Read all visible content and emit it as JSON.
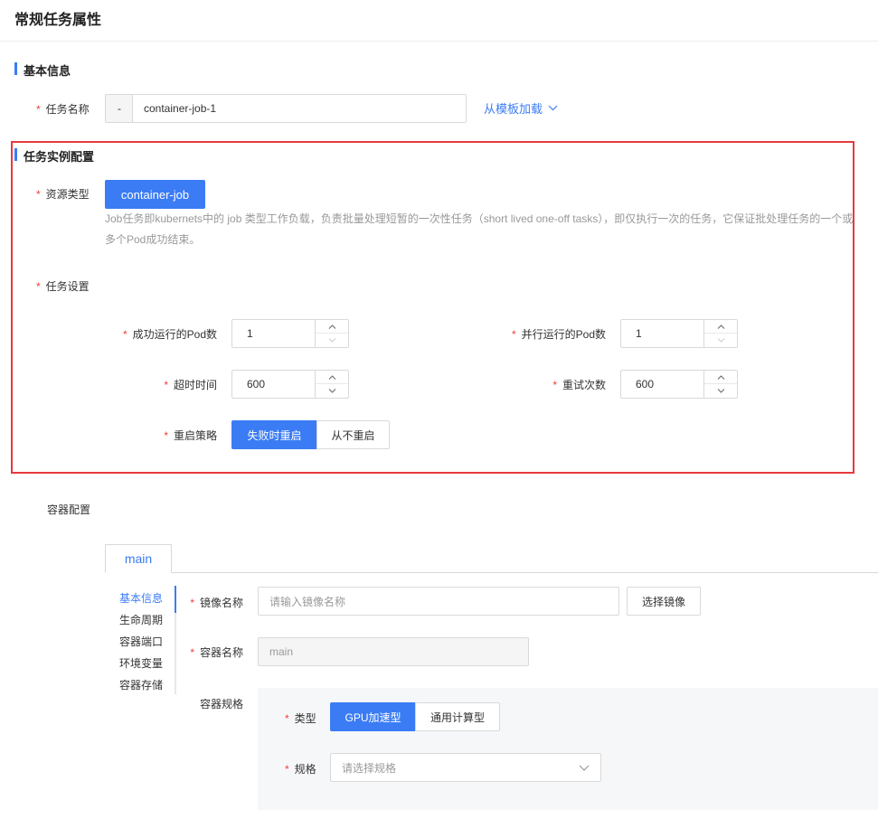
{
  "page": {
    "title": "常规任务属性"
  },
  "basic": {
    "section_title": "基本信息",
    "required_mark": "*",
    "task_name_label": "任务名称",
    "task_name_prefix": "-",
    "task_name_value": "container-job-1",
    "template_link": "从模板加载"
  },
  "instance": {
    "section_title": "任务实例配置",
    "resource_type_label": "资源类型",
    "resource_type_value": "container-job",
    "description_line1": "Job任务即kubernets中的 job 类型工作负载，负责批量处理短暂的一次性任务（short lived one-off tasks），即仅执行一次的任务，它保证批处理任务的一个或",
    "description_line2": "多个Pod成功结束。",
    "task_settings_label": "任务设置",
    "success_pods_label": "成功运行的Pod数",
    "success_pods_value": "1",
    "parallel_pods_label": "并行运行的Pod数",
    "parallel_pods_value": "1",
    "timeout_label": "超时时间",
    "timeout_value": "600",
    "retry_label": "重试次数",
    "retry_value": "600",
    "restart_label": "重启策略",
    "restart_options": [
      "失败时重启",
      "从不重启"
    ],
    "restart_selected": "失败时重启",
    "highlight_color": "#e8393c"
  },
  "container": {
    "section_label": "容器配置",
    "tab": "main",
    "side_nav": [
      "基本信息",
      "生命周期",
      "容器端口",
      "环境变量",
      "容器存储"
    ],
    "side_nav_active": "基本信息",
    "image_name_label": "镜像名称",
    "image_name_placeholder": "请输入镜像名称",
    "select_image_button": "选择镜像",
    "container_name_label": "容器名称",
    "container_name_value": "main",
    "spec_label": "容器规格",
    "type_label": "类型",
    "type_options": [
      "GPU加速型",
      "通用计算型"
    ],
    "type_selected": "GPU加速型",
    "flavor_label": "规格",
    "flavor_placeholder": "请选择规格"
  },
  "colors": {
    "accent": "#3b7cf5",
    "required": "#f04134"
  }
}
